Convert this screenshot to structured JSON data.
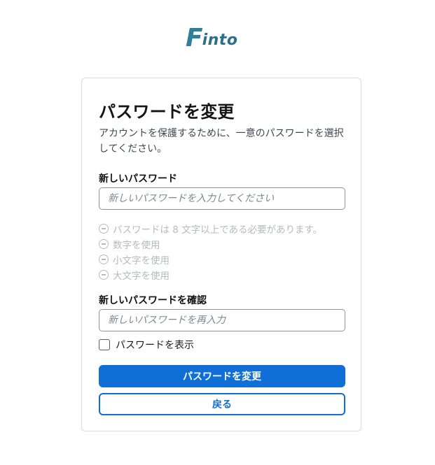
{
  "logo": {
    "text_first": "F",
    "text_rest": "into"
  },
  "card": {
    "title": "パスワードを変更",
    "description": "アカウントを保護するために、一意のパスワードを選択してください。",
    "new_password": {
      "label": "新しいパスワード",
      "placeholder": "新しいパスワードを入力してください",
      "value": ""
    },
    "requirements": [
      {
        "text": "パスワードは 8 文字以上である必要があります。",
        "icon": "minus-circle-icon"
      },
      {
        "text": "数字を使用",
        "icon": "minus-circle-icon"
      },
      {
        "text": "小文字を使用",
        "icon": "minus-circle-icon"
      },
      {
        "text": "大文字を使用",
        "icon": "minus-circle-icon"
      }
    ],
    "confirm_password": {
      "label": "新しいパスワードを確認",
      "placeholder": "新しいパスワードを再入力",
      "value": ""
    },
    "show_password": {
      "label": "パスワードを表示",
      "checked": false
    },
    "submit_label": "パスワードを変更",
    "back_label": "戻る"
  },
  "colors": {
    "primary": "#0f6fd6",
    "logo": "#2f7f98",
    "requirement_muted": "#b6b9bd",
    "border": "#d7d9dd"
  }
}
